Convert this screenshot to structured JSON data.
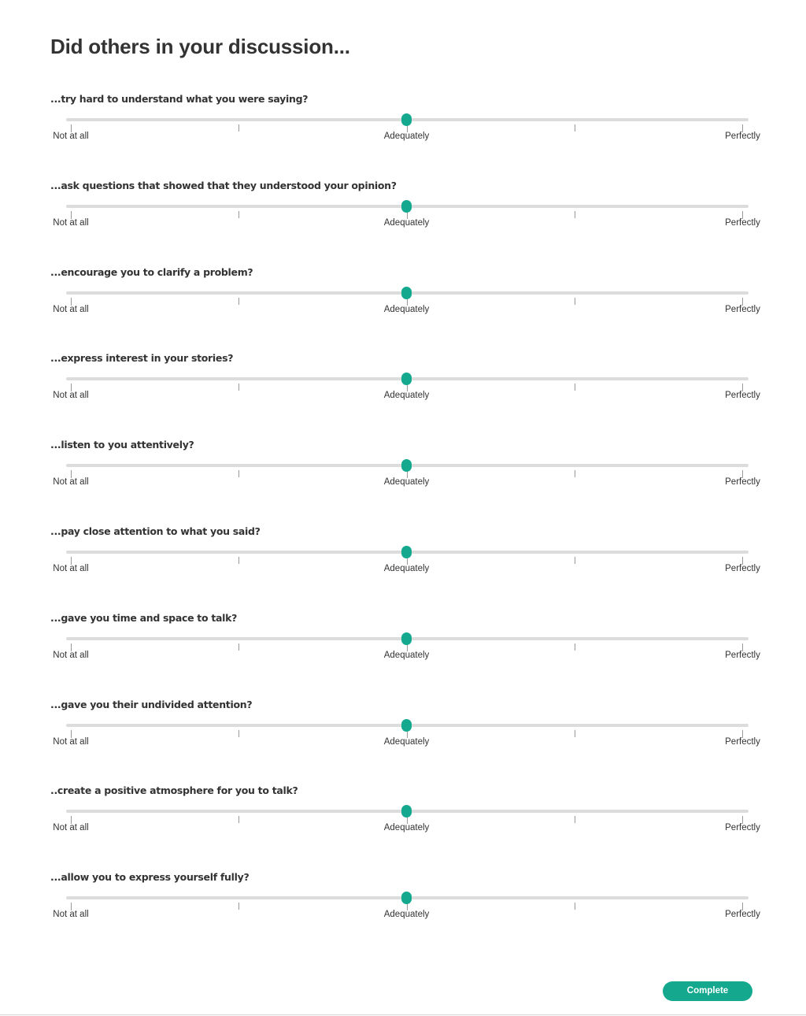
{
  "page": {
    "title": "Did others in your discussion..."
  },
  "scale": {
    "labels": [
      "Not at all",
      "",
      "Adequately",
      "",
      "Perfectly"
    ],
    "min": 0,
    "max": 4
  },
  "questions": [
    {
      "label": "...try hard to understand what you were saying?",
      "value": 2
    },
    {
      "label": "...ask questions that showed that they understood your opinion?",
      "value": 2
    },
    {
      "label": "...encourage you to clarify a problem?",
      "value": 2
    },
    {
      "label": "...express interest in your stories?",
      "value": 2
    },
    {
      "label": "...listen to you attentively?",
      "value": 2
    },
    {
      "label": "...pay close attention to what you said?",
      "value": 2
    },
    {
      "label": "...gave you time and space to talk?",
      "value": 2
    },
    {
      "label": "...gave you their undivided attention?",
      "value": 2
    },
    {
      "label": "..create a positive atmosphere for you to talk?",
      "value": 2
    },
    {
      "label": "...allow you to express yourself fully?",
      "value": 2
    }
  ],
  "footer": {
    "complete_label": "Complete"
  },
  "colors": {
    "accent": "#14a98f",
    "track": "#dcdcdc",
    "text": "#333333"
  }
}
